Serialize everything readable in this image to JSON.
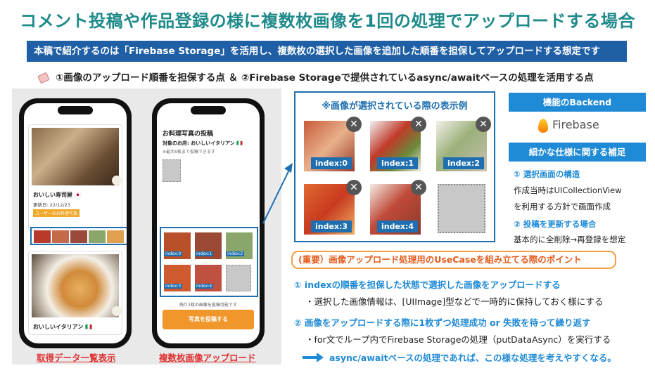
{
  "title": "コメント投稿や作品登録の様に複数枚画像を1回の処理でアップロードする場合",
  "banner": "本稿で紹介するのは「Firebase Storage」を活用し、複数枚の選択した画像を追加した順番を担保してアップロードする想定です",
  "subline": "①画像のアップロード順番を担保する点 ＆ ②Firebase Storageで提供されているasync/awaitベースの処理を活用する点",
  "phone1": {
    "shop1_name": "おいしい寿司屋",
    "shop1_flag": "🇯🇵",
    "shop1_date": "更新日: 22/12/23",
    "user_photos_label": "ユーザーのお料理写真",
    "shop2_name": "おいしいイタリアン",
    "shop2_flag": "🇮🇹",
    "caption": "取得データ一覧表示"
  },
  "phone2": {
    "heading": "お料理写真の投稿",
    "target_shop": "対象のお店: おいしいイタリアン 🇮🇹",
    "note": "※最大6枚まで投稿できます",
    "remaining": "残り1枚の画像を投稿可能です",
    "submit_label": "写真を投稿する",
    "caption": "複数枚画像アップロード",
    "indices": [
      "index:0",
      "index:1",
      "index:2",
      "index:3",
      "index:4"
    ]
  },
  "example": {
    "title": "※画像が選択されている際の表示例",
    "close_glyph": "✕",
    "indices": [
      "index:0",
      "index:1",
      "index:2",
      "index:3",
      "index:4"
    ]
  },
  "side": {
    "backend_head": "機能のBackend",
    "firebase_label": "Firebase",
    "detail_head": "細かな仕様に関する補足",
    "item1_title": "① 選択画面の構造",
    "item1_line1": "作成当時はUICollectionView",
    "item1_line2": "を利用する方針で画面作成",
    "item2_title": "② 投稿を更新する場合",
    "item2_line1": "基本的に全削除→再登録を想定"
  },
  "points": {
    "header": "(重要）画像アップロード処理用のUseCaseを組み立てる際のポイント",
    "p1_title": "① indexの順番を担保した状態で選択した画像をアップロードする",
    "p1_detail": "・選択した画像情報は、[UIImage]型などで一時的に保持しておく様にする",
    "p2_title": "② 画像をアップロードする際に1枚ずつ処理成功 or 失敗を待って繰り返す",
    "p2_detail": "・for文でループ内でFirebase Storageの処理（putDataAsync）を実行する",
    "conclusion": "async/awaitベースの処理であれば、この様な処理を考えやすくなる。"
  },
  "colors": {
    "title": "#1f8a8a",
    "banner": "#1f5fa6",
    "accent_blue": "#1f8ad6",
    "accent_orange": "#f0a040",
    "caption_red": "#e03030"
  }
}
